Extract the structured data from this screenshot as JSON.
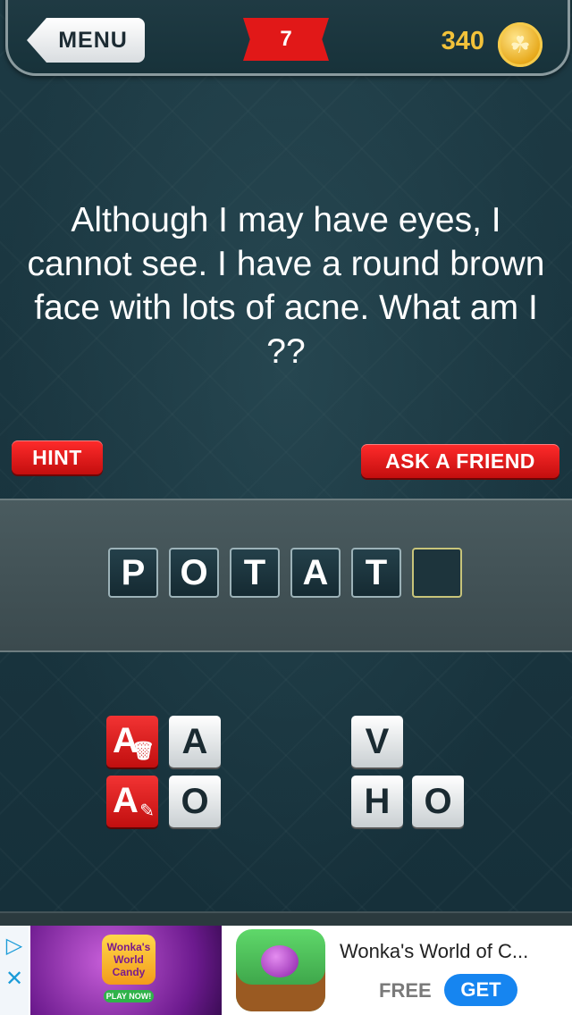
{
  "header": {
    "menu_label": "MENU",
    "level": "7",
    "coins": "340"
  },
  "question": "Although I may have eyes, I cannot see. I have a round brown face with lots of acne. What am I ??",
  "buttons": {
    "hint": "HINT",
    "ask_friend": "ASK A FRIEND"
  },
  "answer_slots": [
    "P",
    "O",
    "T",
    "A",
    "T",
    ""
  ],
  "tools": [
    {
      "letter": "A",
      "icon": "trash-icon"
    },
    {
      "letter": "A",
      "icon": "pencil-icon"
    }
  ],
  "letter_tiles": [
    "A",
    "O",
    "V",
    "H",
    "O"
  ],
  "ad": {
    "banner_text": "Wonka's World Candy",
    "banner_button": "PLAY NOW!",
    "title": "Wonka's World of C...",
    "price": "FREE",
    "get_label": "GET"
  },
  "colors": {
    "accent_red": "#e11818",
    "coin_gold": "#f2c23a",
    "background": "#17313a",
    "get_blue": "#1685f0"
  }
}
